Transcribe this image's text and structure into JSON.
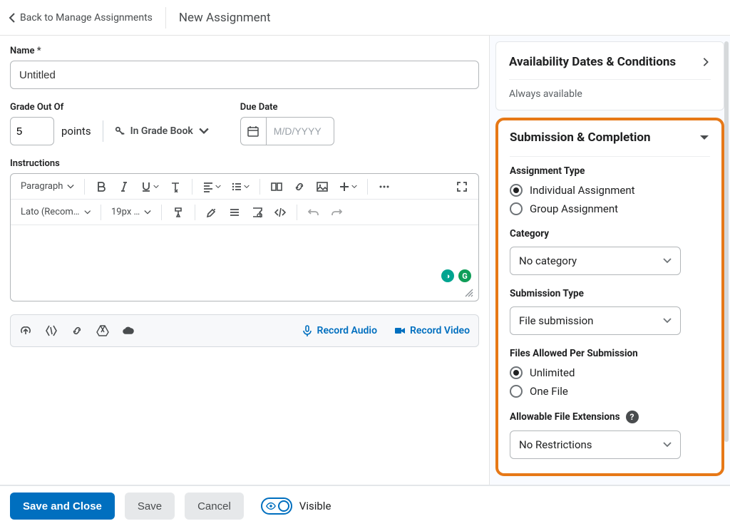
{
  "header": {
    "back_label": "Back to Manage Assignments",
    "title": "New Assignment"
  },
  "main": {
    "name_label": "Name",
    "name_required": "*",
    "name_value": "Untitled",
    "grade_label": "Grade Out Of",
    "grade_value": "5",
    "points_label": "points",
    "gradebook_label": "In Grade Book",
    "due_label": "Due Date",
    "due_placeholder": "M/D/YYYY",
    "instructions_label": "Instructions",
    "toolbar": {
      "paragraph": "Paragraph",
      "font": "Lato (Recom…",
      "size": "19px …"
    },
    "attach": {
      "record_audio": "Record Audio",
      "record_video": "Record Video"
    }
  },
  "side": {
    "avail": {
      "title": "Availability Dates & Conditions",
      "status": "Always available"
    },
    "submission": {
      "title": "Submission & Completion",
      "assignment_type_label": "Assignment Type",
      "type_individual": "Individual Assignment",
      "type_group": "Group Assignment",
      "category_label": "Category",
      "category_value": "No category",
      "submission_type_label": "Submission Type",
      "submission_type_value": "File submission",
      "files_allowed_label": "Files Allowed Per Submission",
      "files_unlimited": "Unlimited",
      "files_one": "One File",
      "extensions_label": "Allowable File Extensions",
      "extensions_value": "No Restrictions"
    }
  },
  "footer": {
    "save_close": "Save and Close",
    "save": "Save",
    "cancel": "Cancel",
    "visible": "Visible"
  }
}
